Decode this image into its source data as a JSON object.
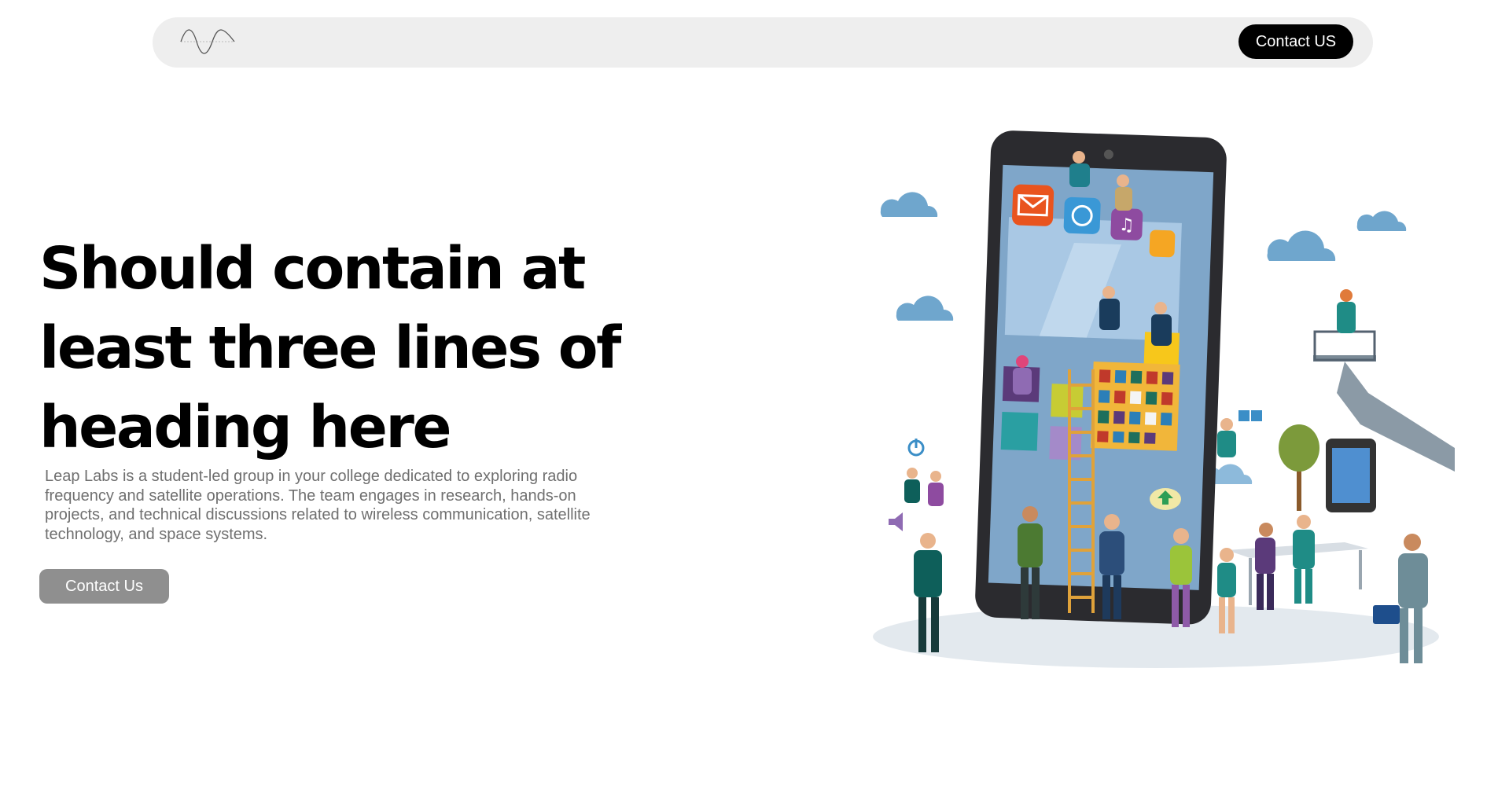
{
  "header": {
    "logo_icon": "sine-wave-logo-icon",
    "cta_label": "Contact US"
  },
  "hero": {
    "title": "Should contain at least three lines of heading here",
    "description": "Leap Labs is a student-led group in your college dedicated to exploring radio frequency and satellite operations. The team engages in research, hands-on projects, and technical discussions related to wireless communication, satellite technology, and space systems.",
    "cta_label": "Contact Us"
  },
  "illustration": {
    "icons": [
      "mail-icon",
      "bird-icon",
      "music-icon",
      "note-icon",
      "power-icon",
      "speaker-icon",
      "upload-arrow-icon",
      "book-icon"
    ]
  },
  "colors": {
    "navbar_bg": "#eeeeee",
    "primary_button": "#000000",
    "secondary_button": "#8f8f8f",
    "body_text": "#6f6f6f"
  }
}
